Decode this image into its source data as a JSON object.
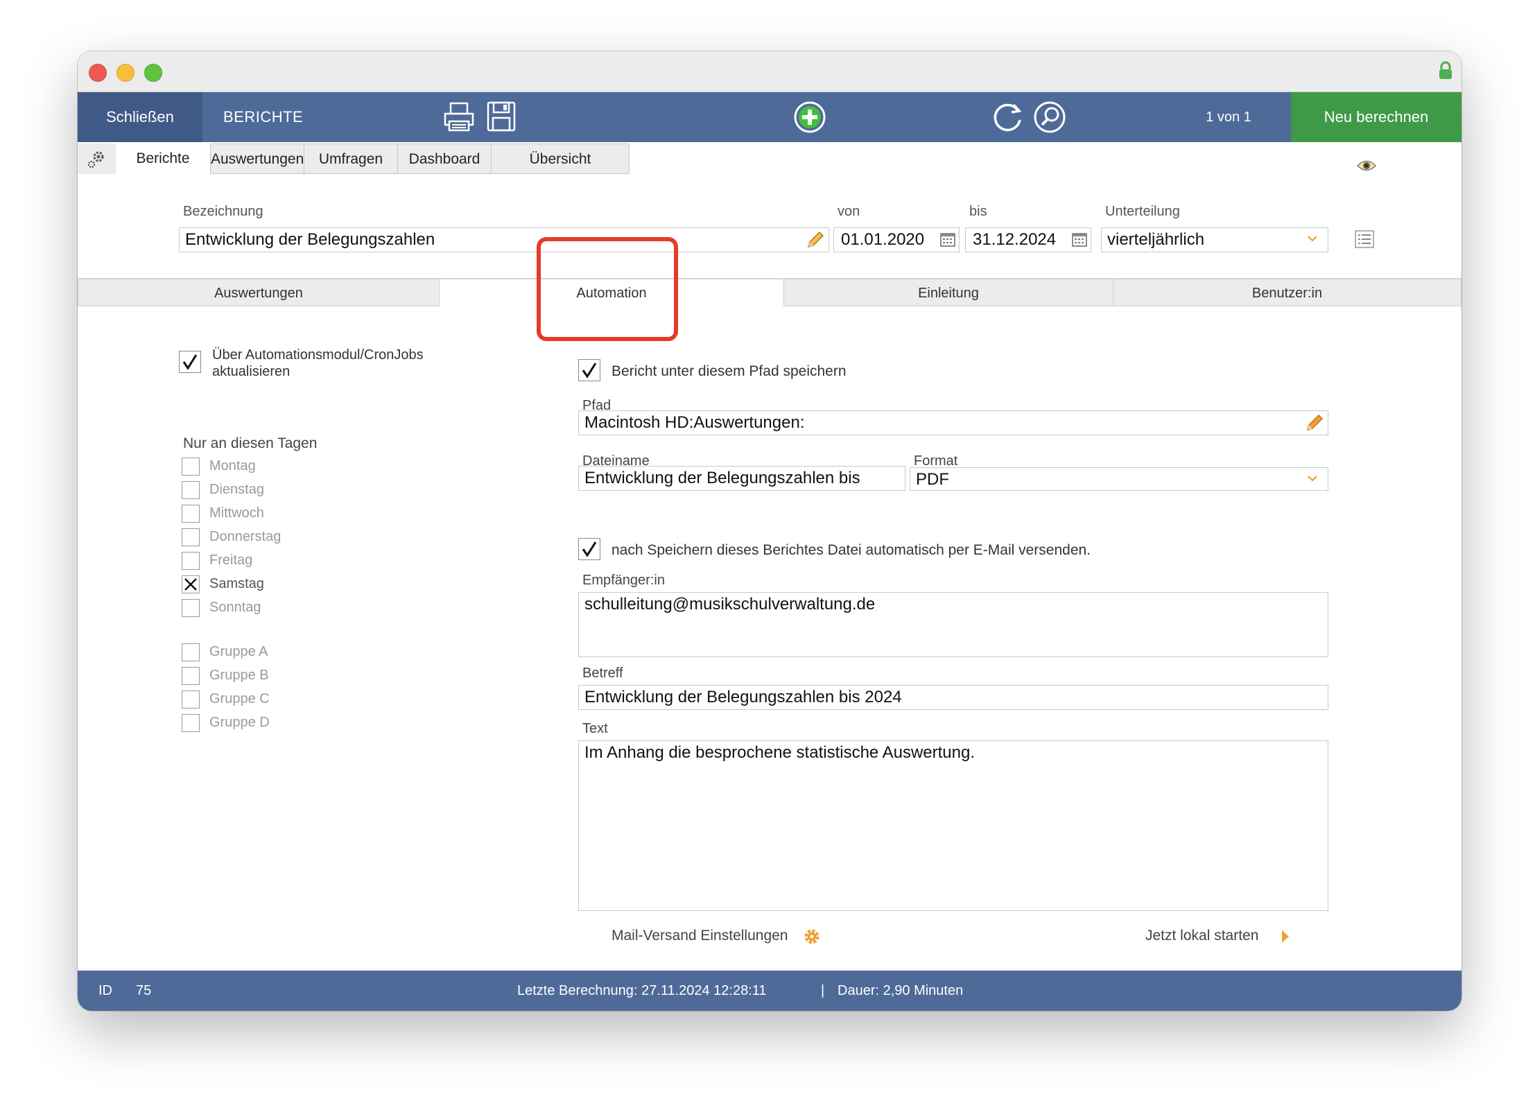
{
  "toolbar": {
    "close_label": "Schließen",
    "title": "BERICHTE",
    "record_nav": "1 von 1",
    "recalc_label": "Neu berechnen"
  },
  "main_tabs": [
    "Berichte",
    "Auswertungen",
    "Umfragen",
    "Dashboard",
    "Übersicht"
  ],
  "form": {
    "bezeichnung_label": "Bezeichnung",
    "bezeichnung_value": "Entwicklung der Belegungszahlen",
    "von_label": "von",
    "von_value": "01.01.2020",
    "bis_label": "bis",
    "bis_value": "31.12.2024",
    "unterteilung_label": "Unterteilung",
    "unterteilung_value": "vierteljährlich"
  },
  "sub_tabs": [
    "Auswertungen",
    "Automation",
    "Einleitung",
    "Benutzer:in"
  ],
  "automation": {
    "cron_label_line1": "Über Automationsmodul/CronJobs",
    "cron_label_line2": "aktualisieren",
    "cron_checked": true,
    "days_title": "Nur an diesen Tagen",
    "days": [
      {
        "label": "Montag",
        "checked": false
      },
      {
        "label": "Dienstag",
        "checked": false
      },
      {
        "label": "Mittwoch",
        "checked": false
      },
      {
        "label": "Donnerstag",
        "checked": false
      },
      {
        "label": "Freitag",
        "checked": false
      },
      {
        "label": "Samstag",
        "checked": true
      },
      {
        "label": "Sonntag",
        "checked": false
      }
    ],
    "groups": [
      {
        "label": "Gruppe A",
        "checked": false
      },
      {
        "label": "Gruppe B",
        "checked": false
      },
      {
        "label": "Gruppe C",
        "checked": false
      },
      {
        "label": "Gruppe D",
        "checked": false
      }
    ],
    "save_path_label": "Bericht unter diesem Pfad speichern",
    "save_path_checked": true,
    "pfad_label": "Pfad",
    "pfad_value": "Macintosh HD:Auswertungen:",
    "dateiname_label": "Dateiname",
    "dateiname_value": "Entwicklung der Belegungszahlen bis",
    "format_label": "Format",
    "format_value": "PDF",
    "email_label": "nach Speichern dieses Berichtes Datei automatisch per E-Mail versenden.",
    "email_checked": true,
    "empfaenger_label": "Empfänger:in",
    "empfaenger_value": "schulleitung@musikschulverwaltung.de",
    "betreff_label": "Betreff",
    "betreff_value": "Entwicklung der Belegungszahlen bis 2024",
    "text_label": "Text",
    "text_value": "Im Anhang die besprochene statistische Auswertung.",
    "mail_settings_label": "Mail-Versand Einstellungen",
    "run_local_label": "Jetzt lokal starten"
  },
  "status": {
    "id_label": "ID",
    "id_value": "75",
    "last_calc": "Letzte Berechnung: 27.11.2024 12:28:11",
    "separator": "|",
    "duration": "Dauer: 2,90 Minuten"
  },
  "colors": {
    "toolbar": "#4e6a98",
    "close_button": "#3f5a87",
    "recalc_button": "#3e9a47",
    "highlight": "#e43b2a",
    "accent_orange": "#f0a030",
    "lock_green": "#4caf50"
  }
}
